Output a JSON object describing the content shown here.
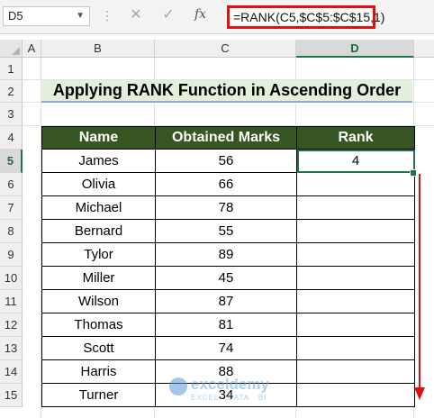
{
  "formula_bar": {
    "name_box": "D5",
    "fx_label": "fx",
    "formula": "=RANK(C5,$C$5:$C$15,1)"
  },
  "columns": [
    "A",
    "B",
    "C",
    "D"
  ],
  "rows": [
    "1",
    "2",
    "3",
    "4",
    "5",
    "6",
    "7",
    "8",
    "9",
    "10",
    "11",
    "12",
    "13",
    "14",
    "15"
  ],
  "selected_cell": "D5",
  "sheet": {
    "title": "Applying RANK Function in Ascending Order",
    "headers": [
      "Name",
      "Obtained Marks",
      "Rank"
    ],
    "records": [
      {
        "name": "James",
        "marks": "56",
        "rank": "4"
      },
      {
        "name": "Olivia",
        "marks": "66",
        "rank": ""
      },
      {
        "name": "Michael",
        "marks": "78",
        "rank": ""
      },
      {
        "name": "Bernard",
        "marks": "55",
        "rank": ""
      },
      {
        "name": "Tylor",
        "marks": "89",
        "rank": ""
      },
      {
        "name": "Miller",
        "marks": "45",
        "rank": ""
      },
      {
        "name": "Wilson",
        "marks": "87",
        "rank": ""
      },
      {
        "name": "Thomas",
        "marks": "81",
        "rank": ""
      },
      {
        "name": "Scott",
        "marks": "74",
        "rank": ""
      },
      {
        "name": "Harris",
        "marks": "88",
        "rank": ""
      },
      {
        "name": "Turner",
        "marks": "34",
        "rank": ""
      }
    ]
  },
  "watermark": {
    "name": "exceldemy",
    "tagline": "EXCEL · DATA · BI"
  },
  "colors": {
    "header_fill": "#375623",
    "title_fill": "#e2efda",
    "highlight": "#e01010",
    "selection": "#217346"
  }
}
